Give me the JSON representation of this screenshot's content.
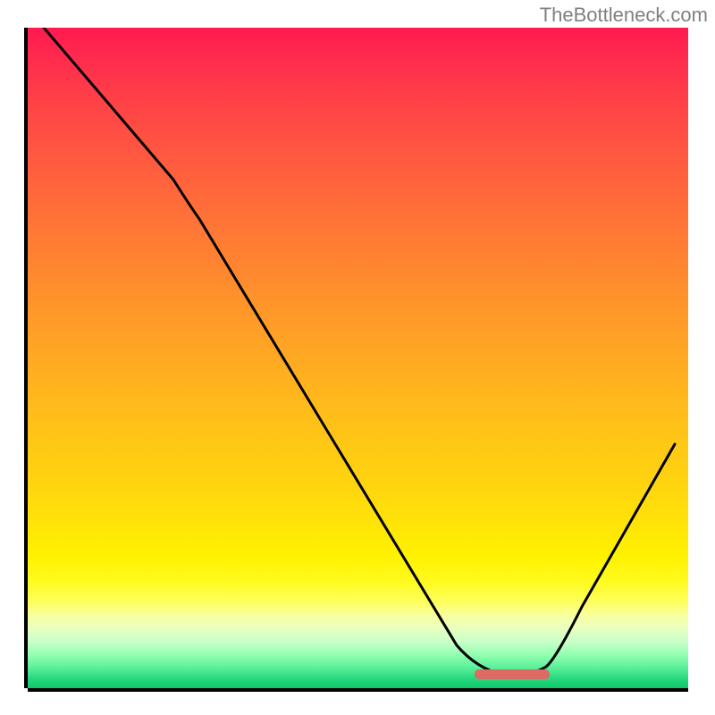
{
  "attribution": "TheBottleneck.com",
  "chart_data": {
    "type": "line",
    "title": "",
    "xlabel": "",
    "ylabel": "",
    "xlim": [
      0,
      100
    ],
    "ylim": [
      0,
      100
    ],
    "curve_points_pct": [
      {
        "x": 2.5,
        "y": 100
      },
      {
        "x": 22,
        "y": 77
      },
      {
        "x": 26,
        "y": 71
      },
      {
        "x": 65,
        "y": 6.5
      },
      {
        "x": 68,
        "y": 3
      },
      {
        "x": 72,
        "y": 2
      },
      {
        "x": 77,
        "y": 2
      },
      {
        "x": 80,
        "y": 4
      },
      {
        "x": 98,
        "y": 37
      }
    ],
    "marker": {
      "x_start_pct": 68,
      "x_end_pct": 79,
      "y_pct": 2,
      "color": "#dd6a63"
    },
    "background": {
      "type": "vertical_gradient",
      "stops": [
        {
          "pos": 0,
          "color": "#ff1a50"
        },
        {
          "pos": 50,
          "color": "#ffb020"
        },
        {
          "pos": 82,
          "color": "#fff800"
        },
        {
          "pos": 100,
          "color": "#18d070"
        }
      ]
    }
  }
}
